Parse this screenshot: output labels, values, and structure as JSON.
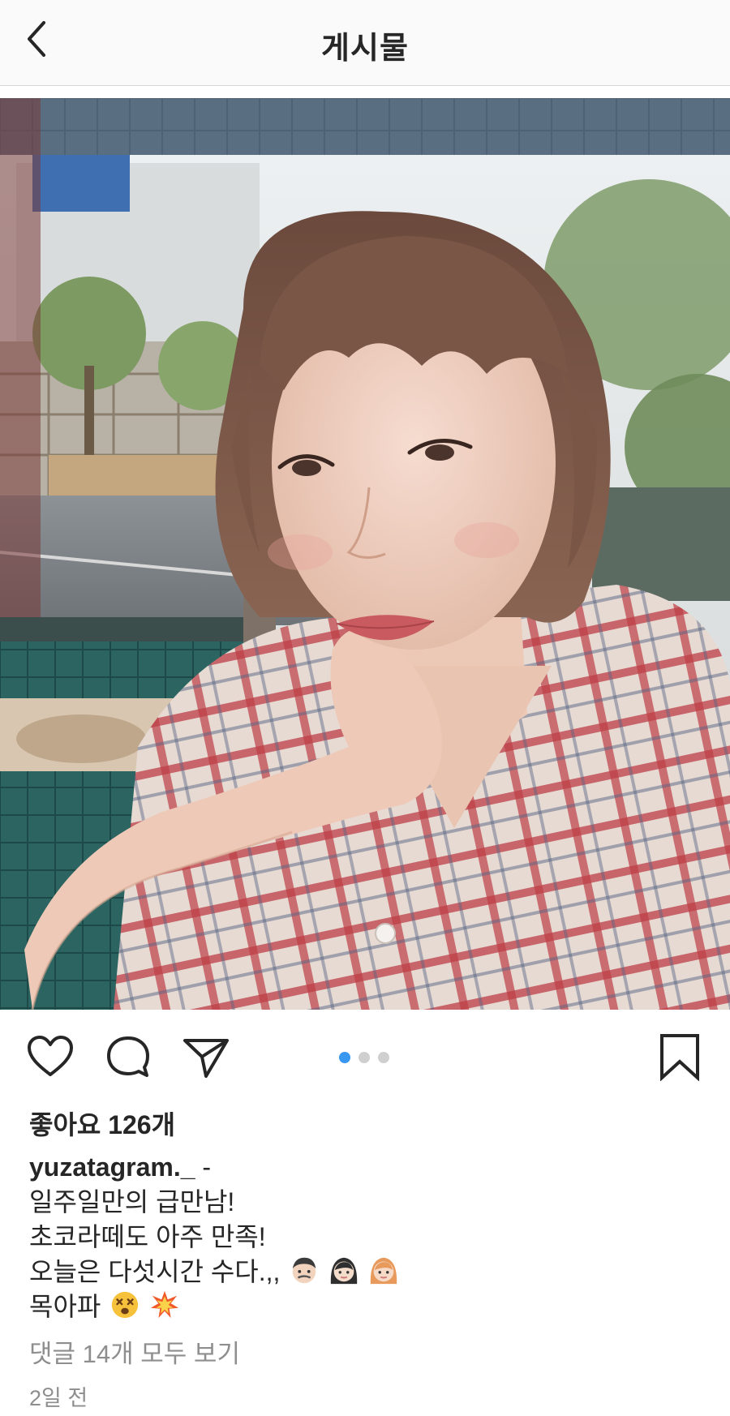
{
  "header": {
    "title": "게시물",
    "back_icon": "chevron-left-icon"
  },
  "post": {
    "photo_description": "Selfie photo",
    "carousel": {
      "total": 3,
      "active": 1
    },
    "actions": {
      "like_icon": "heart-icon",
      "comment_icon": "comment-icon",
      "share_icon": "paper-plane-icon",
      "save_icon": "bookmark-icon"
    },
    "likes_text": "좋아요 126개",
    "caption": {
      "username": "yuzatagram._",
      "separator": "-",
      "line1": "일주일만의 급만남!",
      "line2": "초코라떼도 아주 만족!",
      "line3": "오늘은 다섯시간 수다.,,",
      "line3_emojis": [
        "man-emoji",
        "woman-emoji",
        "woman-blonde-emoji"
      ],
      "line4": "목아파",
      "line4_emojis": [
        "dizzy-face-emoji",
        "collision-emoji"
      ]
    },
    "view_comments": "댓글 14개 모두 보기",
    "timestamp": "2일 전"
  },
  "colors": {
    "accent_blue": "#3897f0",
    "text_primary": "#262626",
    "text_secondary": "#8e8e8e"
  }
}
